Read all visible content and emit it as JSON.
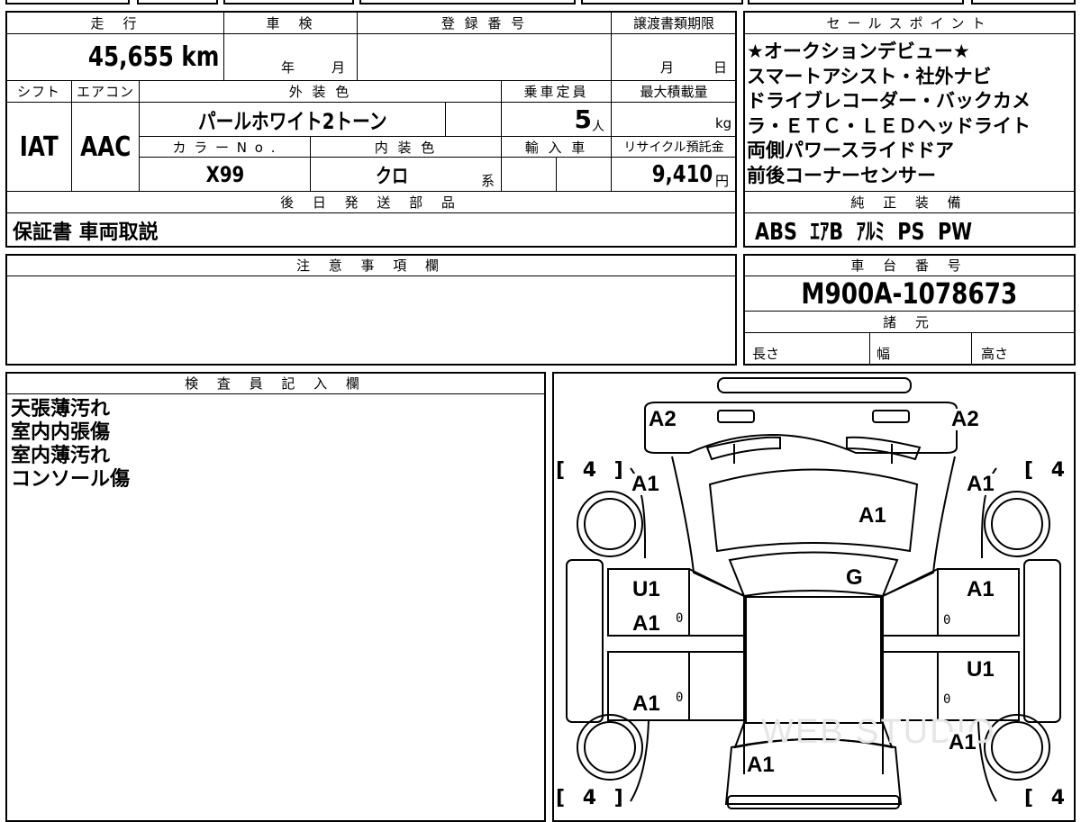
{
  "vehicle": {
    "mileage_label": "走　行",
    "mileage": "45,655 km",
    "inspection_label": "車　検",
    "inspection_year": "年",
    "inspection_month": "月",
    "registration_label": "登 録 番 号",
    "registration_value": "",
    "transfer_label": "譲渡書類期限",
    "transfer_month": "月",
    "transfer_day": "日",
    "shift_label": "シフト",
    "shift": "IAT",
    "ac_label": "エアコン",
    "ac": "AAC",
    "exterior_label": "外 装 色",
    "exterior_color": "パールホワイト2トーン",
    "capacity_label": "乗車定員",
    "capacity": "5",
    "capacity_unit": "人",
    "load_label": "最大積載量",
    "load_unit": "kg",
    "color_no_label": "カ ラ ー N o .",
    "color_no": "X99",
    "interior_label": "内 装 色",
    "interior_color": "クロ",
    "interior_suffix": "系",
    "import_label": "輸 入 車",
    "recycle_label": "リサイクル預託金",
    "recycle_fee": "9,410",
    "recycle_unit": "円",
    "later_parts_label": "後 日 発 送 部 品",
    "later_parts": "保証書 車両取説"
  },
  "sales_points": {
    "label": "セールスポイント",
    "lines": [
      "★オークションデビュー★",
      "スマートアシスト・社外ナビ",
      "ドライブレコーダー・バックカメ",
      "ラ・ＥＴＣ・ＬＥＤヘッドライト",
      "両側パワースライドドア",
      "前後コーナーセンサー"
    ]
  },
  "equipment": {
    "label": "純 正 装 備",
    "value": "ABS  ｴｱB  ｱﾙﾐ  PS  PW"
  },
  "notes": {
    "label": "注 意 事 項 欄",
    "value": ""
  },
  "chassis": {
    "label": "車 台 番 号",
    "number": "M900A-1078673",
    "specs_label": "諸 元",
    "length_label": "長さ",
    "width_label": "幅",
    "height_label": "高さ"
  },
  "inspector": {
    "label": "検 査 員 記 入 欄",
    "remarks": [
      "天張薄汚れ",
      "室内内張傷",
      "室内薄汚れ",
      "コンソール傷"
    ]
  },
  "diagram": {
    "tire_brackets": [
      "[ 4 ]",
      "[ 4 ]",
      "[ 4 ]",
      "[ 4 ]"
    ],
    "damage_marks": [
      "A2",
      "A2",
      "A1",
      "A1",
      "A1",
      "A1",
      "G",
      "U1",
      "A1",
      "A1",
      "U1",
      "A1",
      "A1",
      "A1"
    ],
    "zeros": [
      "0",
      "0",
      "0",
      "0"
    ],
    "watermark": "WEB STUDIO"
  }
}
